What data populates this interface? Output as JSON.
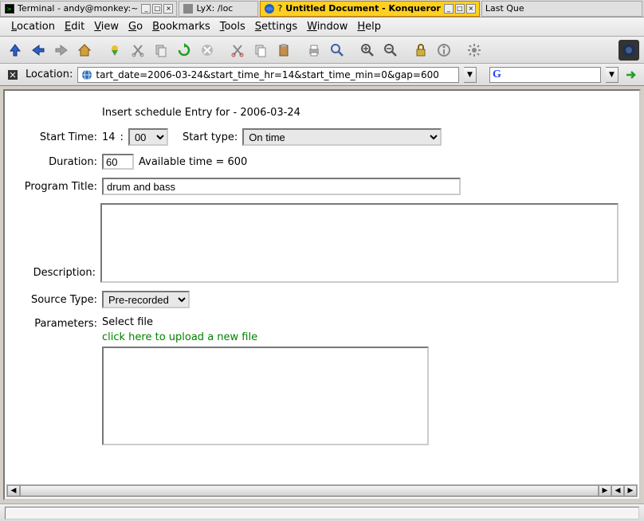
{
  "taskbar": {
    "items": [
      {
        "label": "Terminal - andy@monkey:~",
        "active": false
      },
      {
        "label": "LyX: /loc",
        "active": false
      },
      {
        "label": "Untitled Document - Konqueror",
        "active": true
      },
      {
        "label": "Last Que",
        "active": false
      }
    ]
  },
  "menu": {
    "location": "Location",
    "edit": "Edit",
    "view": "View",
    "go": "Go",
    "bookmarks": "Bookmarks",
    "tools": "Tools",
    "settings": "Settings",
    "window": "Window",
    "help": "Help"
  },
  "location": {
    "label": "Location:",
    "value": "tart_date=2006-03-24&start_time_hr=14&start_time_min=0&gap=600",
    "search_placeholder": ""
  },
  "form": {
    "heading": "Insert schedule Entry for - 2006-03-24",
    "start_time_label": "Start Time:",
    "start_time_hr": "14",
    "start_time_sep": ":",
    "start_time_min": "00",
    "start_type_label": "Start type:",
    "start_type_value": "On time",
    "duration_label": "Duration:",
    "duration_value": "60",
    "available_label": "Available time = 600",
    "program_title_label": "Program Title:",
    "program_title_value": "drum and bass",
    "description_label": "Description:",
    "description_value": "",
    "source_type_label": "Source Type:",
    "source_type_value": "Pre-recorded",
    "parameters_label": "Parameters:",
    "select_file_label": "Select file",
    "upload_link": "click here to upload a new file"
  }
}
